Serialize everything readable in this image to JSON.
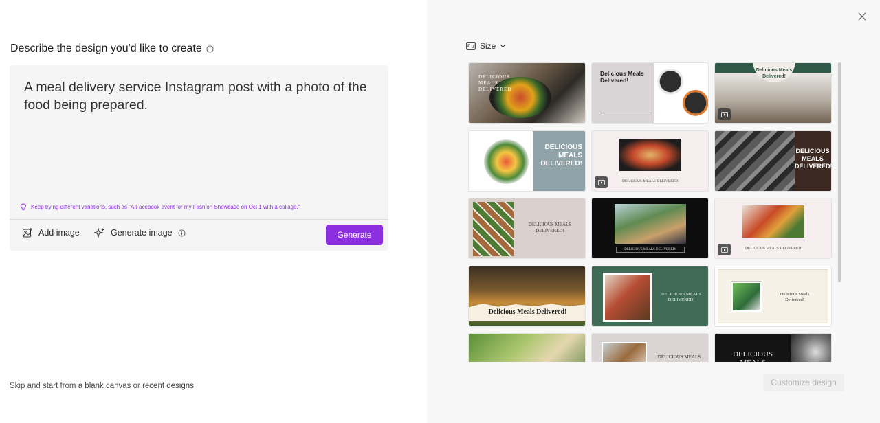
{
  "left": {
    "heading": "Describe the design you'd like to create",
    "prompt_text": "A meal delivery service Instagram post with a photo of the food being prepared.",
    "tip": "Keep trying different variations, such as \"A Facebook event for my Fashion Showcase on Oct 1 with a collage.\"",
    "add_image_label": "Add image",
    "generate_image_label": "Generate image",
    "generate_button": "Generate",
    "skip_prefix": "Skip and start from",
    "skip_blank": "a blank canvas",
    "skip_or": "or",
    "skip_recent": "recent designs"
  },
  "right": {
    "size_label": "Size",
    "customize_button": "Customize design",
    "templates": [
      {
        "label": "DELICIOUS MEALS DELIVERED",
        "video": false
      },
      {
        "label": "Delicious Meals Delivered!",
        "video": false
      },
      {
        "label": "Delicious Meals Delivered!",
        "video": true
      },
      {
        "label": "DELICIOUS MEALS DELIVERED!",
        "video": false
      },
      {
        "label": "DELICIOUS MEALS DELIVERED!",
        "video": true
      },
      {
        "label": "DELICIOUS MEALS DELIVERED!",
        "video": false
      },
      {
        "label": "DELICIOUS MEALS DELIVERED!",
        "video": false
      },
      {
        "label": "DELICIOUS MEALS DELIVERED!",
        "video": false
      },
      {
        "label": "DELICIOUS MEALS DELIVERED!",
        "video": true
      },
      {
        "label": "Delicious Meals Delivered!",
        "video": false
      },
      {
        "label": "DELICIOUS MEALS DELIVERED!",
        "video": false
      },
      {
        "label": "Delicious Meals Delivered!",
        "video": false
      },
      {
        "label": "",
        "video": false
      },
      {
        "label": "DELICIOUS MEALS",
        "video": false
      },
      {
        "label": "DELICIOUS MEALS",
        "video": false
      }
    ]
  },
  "colors": {
    "accent": "#8b2fe0",
    "tip": "#8a2be2",
    "green_tile": "#3f6b57",
    "dark_tile": "#111111"
  }
}
